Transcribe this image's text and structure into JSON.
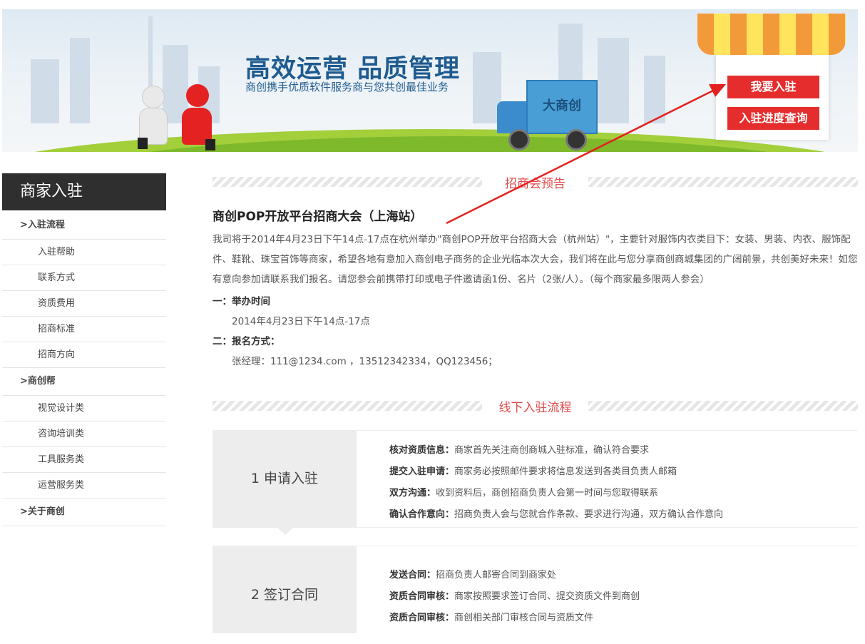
{
  "banner": {
    "title": "高效运营  品质管理",
    "subtitle": "商创携手优质软件服务商与您共创最佳业务",
    "truck_label": "大商创",
    "apply_button": "我要入驻",
    "progress_button": "入驻进度查询"
  },
  "sidebar": {
    "title": "商家入驻",
    "items": [
      {
        "label": ">入驻流程",
        "type": "category"
      },
      {
        "label": "入驻帮助",
        "type": "sub"
      },
      {
        "label": "联系方式",
        "type": "sub"
      },
      {
        "label": "资质费用",
        "type": "sub"
      },
      {
        "label": "招商标准",
        "type": "sub"
      },
      {
        "label": "招商方向",
        "type": "sub"
      },
      {
        "label": ">商创帮",
        "type": "category"
      },
      {
        "label": "视觉设计类",
        "type": "sub"
      },
      {
        "label": "咨询培训类",
        "type": "sub"
      },
      {
        "label": "工具服务类",
        "type": "sub"
      },
      {
        "label": "运营服务类",
        "type": "sub"
      },
      {
        "label": ">关于商创",
        "type": "category"
      }
    ]
  },
  "section1": {
    "heading": "招商会预告",
    "article_title": "商创POP开放平台招商大会（上海站）",
    "article_body": "我司将于2014年4月23日下午14点-17点在杭州举办\"商创POP开放平台招商大会（杭州站）\"，主要针对服饰内衣类目下：女装、男装、内衣、服饰配件、鞋靴、珠宝首饰等商家，希望各地有意加入商创电子商务的企业光临本次大会，我们将在此与您分享商创商城集团的广阔前景，共创美好未来！如您有意向参加请联系我们报名。请您参会前携带打印或电子件邀请函1份、名片（2张/人）。（每个商家最多限两人参会）",
    "time_label": "一：举办时间",
    "time_value": "2014年4月23日下午14点-17点",
    "signup_label": "二：报名方式：",
    "signup_value": "张经理：111@1234.com ，13512342334，QQ123456；"
  },
  "section2": {
    "heading": "线下入驻流程",
    "steps": [
      {
        "title": "1 申请入驻",
        "lines": [
          {
            "label": "核对资质信息：",
            "text": "商家首先关注商创商城入驻标准，确认符合要求"
          },
          {
            "label": "提交入驻申请：",
            "text": "商家务必按照邮件要求将信息发送到各类目负责人邮箱"
          },
          {
            "label": "双方沟通：",
            "text": "收到资料后，商创招商负责人会第一时间与您取得联系"
          },
          {
            "label": "确认合作意向：",
            "text": "招商负责人会与您就合作条款、要求进行沟通，双方确认合作意向"
          }
        ]
      },
      {
        "title": "2 签订合同",
        "lines": [
          {
            "label": "发送合同：",
            "text": "招商负责人邮寄合同到商家处"
          },
          {
            "label": "资质合同审核：",
            "text": "商家按照要求签订合同、提交资质文件到商创"
          },
          {
            "label": "资质合同审核：",
            "text": "商创相关部门审核合同与资质文件"
          }
        ]
      }
    ]
  },
  "colors": {
    "accent_red": "#e52d2d",
    "heading_red": "#e04a4a",
    "banner_blue": "#1f5b8f",
    "sidebar_dark": "#2f2f2f"
  }
}
